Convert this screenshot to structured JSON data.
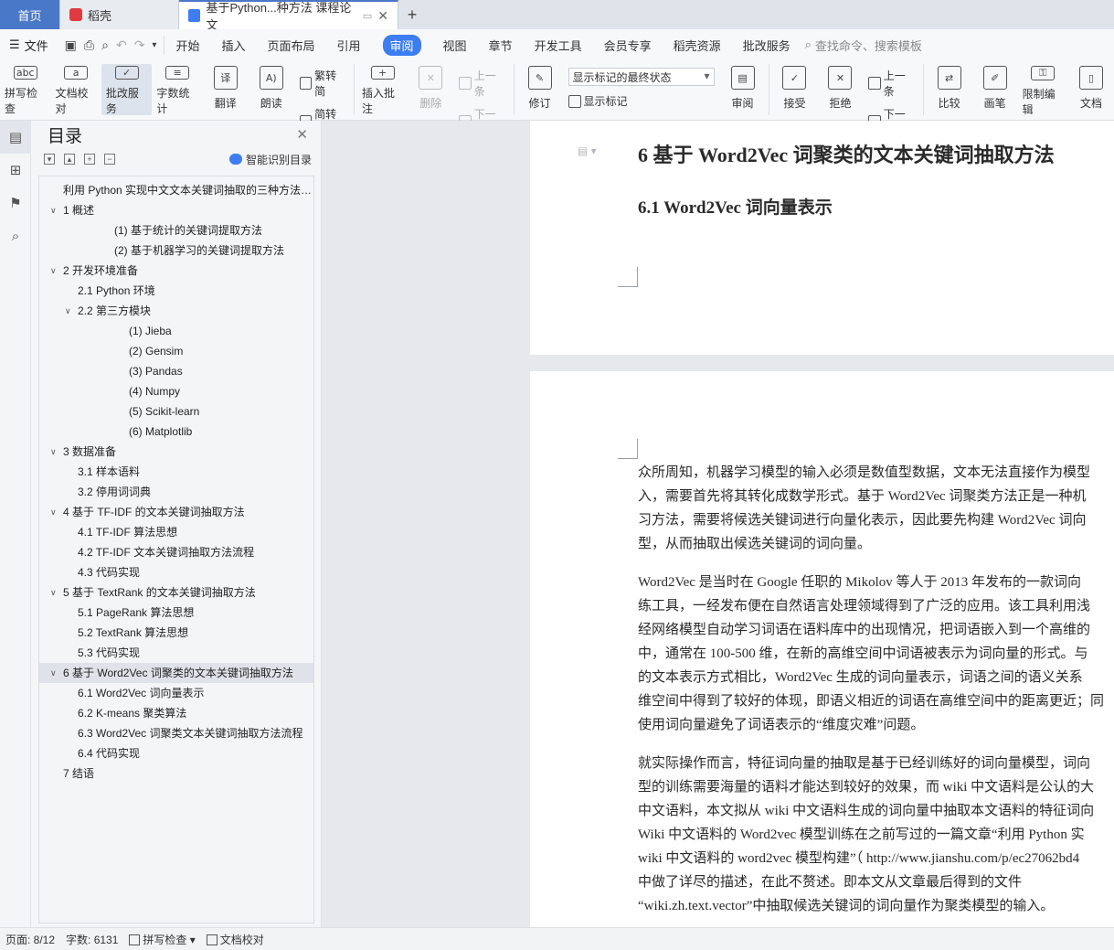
{
  "tabs": {
    "home": "首页",
    "daoke": "稻壳",
    "doc": "基于Python...种方法 课程论文",
    "add": "+"
  },
  "menu": {
    "file": "文件",
    "items": [
      "开始",
      "插入",
      "页面布局",
      "引用",
      "审阅",
      "视图",
      "章节",
      "开发工具",
      "会员专享",
      "稻壳资源",
      "批改服务"
    ],
    "active": "审阅",
    "search": "查找命令、搜索模板"
  },
  "ribbon": {
    "spell": "拼写检查",
    "proof": "文档校对",
    "correct": "批改服务",
    "wordcount": "字数统计",
    "translate": "翻译",
    "read": "朗读",
    "fan2jian": "繁转简",
    "jian2fan": "简转繁",
    "insert_comment": "插入批注",
    "delete": "删除",
    "prev_comment": "上一条",
    "next_comment": "下一条",
    "track": "修订",
    "markup_state": "显示标记的最终状态",
    "show_markup": "显示标记",
    "review": "审阅",
    "accept": "接受",
    "reject": "拒绝",
    "prev_change": "上一条",
    "next_change": "下一条",
    "compare": "比较",
    "pen": "画笔",
    "restrict": "限制编辑",
    "doc_more": "文档"
  },
  "nav": {
    "title": "目录",
    "smart": "智能识别目录",
    "items": [
      {
        "text": "利用 Python 实现中文文本关键词抽取的三种方法 课程论文",
        "level": 0,
        "caret": ""
      },
      {
        "text": "1  概述",
        "level": 1,
        "caret": "∨"
      },
      {
        "text": "(1)  基于统计的关键词提取方法",
        "level": 3,
        "caret": ""
      },
      {
        "text": "(2)  基于机器学习的关键词提取方法",
        "level": 3,
        "caret": ""
      },
      {
        "text": "2  开发环境准备",
        "level": 1,
        "caret": "∨"
      },
      {
        "text": "2.1 Python 环境",
        "level": 2,
        "caret": ""
      },
      {
        "text": "2.2  第三方模块",
        "level": 2,
        "caret": "∨"
      },
      {
        "text": "(1)  Jieba",
        "level": 4,
        "caret": ""
      },
      {
        "text": "(2)  Gensim",
        "level": 4,
        "caret": ""
      },
      {
        "text": "(3)  Pandas",
        "level": 4,
        "caret": ""
      },
      {
        "text": "(4)  Numpy",
        "level": 4,
        "caret": ""
      },
      {
        "text": "(5)  Scikit-learn",
        "level": 4,
        "caret": ""
      },
      {
        "text": "(6)  Matplotlib",
        "level": 4,
        "caret": ""
      },
      {
        "text": "3  数据准备",
        "level": 1,
        "caret": "∨"
      },
      {
        "text": "3.1  样本语料",
        "level": 2,
        "caret": ""
      },
      {
        "text": "3.2  停用词词典",
        "level": 2,
        "caret": ""
      },
      {
        "text": "4  基于 TF-IDF 的文本关键词抽取方法",
        "level": 1,
        "caret": "∨"
      },
      {
        "text": "4.1 TF-IDF 算法思想",
        "level": 2,
        "caret": ""
      },
      {
        "text": "4.2 TF-IDF 文本关键词抽取方法流程",
        "level": 2,
        "caret": ""
      },
      {
        "text": "4.3  代码实现",
        "level": 2,
        "caret": ""
      },
      {
        "text": "5  基于 TextRank 的文本关键词抽取方法",
        "level": 1,
        "caret": "∨"
      },
      {
        "text": "5.1 PageRank 算法思想",
        "level": 2,
        "caret": ""
      },
      {
        "text": "5.2 TextRank 算法思想",
        "level": 2,
        "caret": ""
      },
      {
        "text": "5.3  代码实现",
        "level": 2,
        "caret": ""
      },
      {
        "text": "6  基于 Word2Vec 词聚类的文本关键词抽取方法",
        "level": 1,
        "caret": "∨",
        "selected": true
      },
      {
        "text": "6.1 Word2Vec 词向量表示",
        "level": 2,
        "caret": ""
      },
      {
        "text": "6.2 K-means 聚类算法",
        "level": 2,
        "caret": ""
      },
      {
        "text": "6.3 Word2Vec 词聚类文本关键词抽取方法流程",
        "level": 2,
        "caret": ""
      },
      {
        "text": "6.4  代码实现",
        "level": 2,
        "caret": ""
      },
      {
        "text": "7  结语",
        "level": 1,
        "caret": ""
      }
    ]
  },
  "doc": {
    "h1": "6  基于 Word2Vec 词聚类的文本关键词抽取方法",
    "h2": "6.1 Word2Vec 词向量表示",
    "p1": "众所周知，机器学习模型的输入必须是数值型数据，文本无法直接作为模型\n入，需要首先将其转化成数学形式。基于 Word2Vec 词聚类方法正是一种机\n习方法，需要将候选关键词进行向量化表示，因此要先构建 Word2Vec 词向\n型，从而抽取出候选关键词的词向量。",
    "p2": "Word2Vec 是当时在 Google 任职的 Mikolov 等人于 2013 年发布的一款词向\n练工具，一经发布便在自然语言处理领域得到了广泛的应用。该工具利用浅\n经网络模型自动学习词语在语料库中的出现情况，把词语嵌入到一个高维的\n中，通常在 100-500 维，在新的高维空间中词语被表示为词向量的形式。与\n的文本表示方式相比，Word2Vec 生成的词向量表示，词语之间的语义关系\n维空间中得到了较好的体现，即语义相近的词语在高维空间中的距离更近；同\n使用词向量避免了词语表示的“维度灾难”问题。",
    "p3": "就实际操作而言，特征词向量的抽取是基于已经训练好的词向量模型，词向\n型的训练需要海量的语料才能达到较好的效果，而 wiki 中文语料是公认的大\n中文语料，本文拟从 wiki 中文语料生成的词向量中抽取本文语料的特征词向\nWiki 中文语料的 Word2vec 模型训练在之前写过的一篇文章“利用 Python 实\nwiki 中文语料的 word2vec 模型构建”（  http://www.jianshu.com/p/ec27062bd4\n中做了详尽的描述，在此不赘述。即本文从文章最后得到的文件\n“wiki.zh.text.vector”中抽取候选关键词的词向量作为聚类模型的输入。"
  },
  "status": {
    "page": "页面: 8/12",
    "words": "字数: 6131",
    "spell": "拼写检查",
    "proof": "文档校对"
  }
}
